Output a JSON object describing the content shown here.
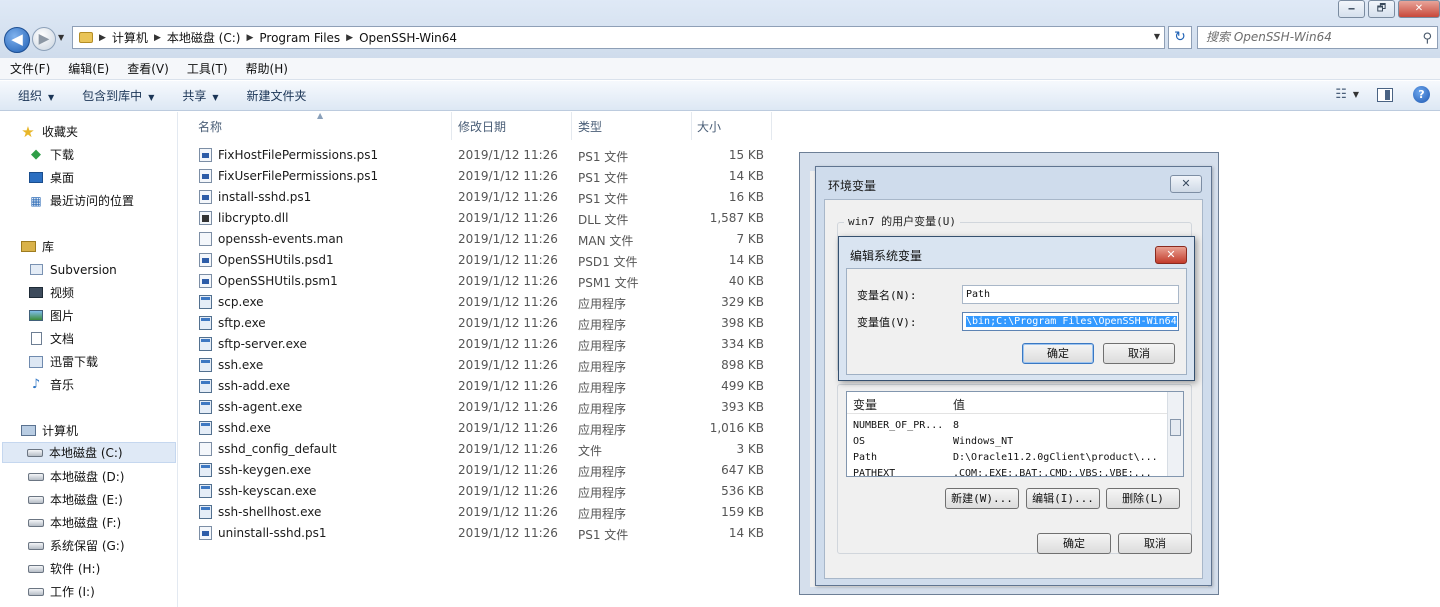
{
  "window": {
    "minimize": "🗕",
    "maximize": "🗗",
    "close": "✕"
  },
  "address": {
    "crumbs": [
      "计算机",
      "本地磁盘 (C:)",
      "Program Files",
      "OpenSSH-Win64"
    ],
    "search_placeholder": "搜索 OpenSSH-Win64"
  },
  "menu": [
    "文件(F)",
    "编辑(E)",
    "查看(V)",
    "工具(T)",
    "帮助(H)"
  ],
  "toolbar": {
    "organize": "组织",
    "include_in_library": "包含到库中",
    "share": "共享",
    "new_folder": "新建文件夹"
  },
  "nav": {
    "favorites": "收藏夹",
    "downloads": "下载",
    "desktop": "桌面",
    "recent": "最近访问的位置",
    "libraries": "库",
    "subversion": "Subversion",
    "videos": "视频",
    "pictures": "图片",
    "documents": "文档",
    "thunder": "迅雷下载",
    "music": "音乐",
    "computer": "计算机",
    "drives": [
      "本地磁盘 (C:)",
      "本地磁盘 (D:)",
      "本地磁盘 (E:)",
      "本地磁盘 (F:)",
      "系统保留 (G:)",
      "软件 (H:)",
      "工作 (I:)"
    ]
  },
  "columns": {
    "name": "名称",
    "date": "修改日期",
    "type": "类型",
    "size": "大小"
  },
  "files": [
    {
      "name": "FixHostFilePermissions.ps1",
      "date": "2019/1/12 11:26",
      "type": "PS1 文件",
      "size": "15 KB",
      "icon": "ps1"
    },
    {
      "name": "FixUserFilePermissions.ps1",
      "date": "2019/1/12 11:26",
      "type": "PS1 文件",
      "size": "14 KB",
      "icon": "ps1"
    },
    {
      "name": "install-sshd.ps1",
      "date": "2019/1/12 11:26",
      "type": "PS1 文件",
      "size": "16 KB",
      "icon": "ps1"
    },
    {
      "name": "libcrypto.dll",
      "date": "2019/1/12 11:26",
      "type": "DLL 文件",
      "size": "1,587 KB",
      "icon": "dll"
    },
    {
      "name": "openssh-events.man",
      "date": "2019/1/12 11:26",
      "type": "MAN 文件",
      "size": "7 KB",
      "icon": "file"
    },
    {
      "name": "OpenSSHUtils.psd1",
      "date": "2019/1/12 11:26",
      "type": "PSD1 文件",
      "size": "14 KB",
      "icon": "ps1"
    },
    {
      "name": "OpenSSHUtils.psm1",
      "date": "2019/1/12 11:26",
      "type": "PSM1 文件",
      "size": "40 KB",
      "icon": "ps1"
    },
    {
      "name": "scp.exe",
      "date": "2019/1/12 11:26",
      "type": "应用程序",
      "size": "329 KB",
      "icon": "exe"
    },
    {
      "name": "sftp.exe",
      "date": "2019/1/12 11:26",
      "type": "应用程序",
      "size": "398 KB",
      "icon": "exe"
    },
    {
      "name": "sftp-server.exe",
      "date": "2019/1/12 11:26",
      "type": "应用程序",
      "size": "334 KB",
      "icon": "exe"
    },
    {
      "name": "ssh.exe",
      "date": "2019/1/12 11:26",
      "type": "应用程序",
      "size": "898 KB",
      "icon": "exe"
    },
    {
      "name": "ssh-add.exe",
      "date": "2019/1/12 11:26",
      "type": "应用程序",
      "size": "499 KB",
      "icon": "exe"
    },
    {
      "name": "ssh-agent.exe",
      "date": "2019/1/12 11:26",
      "type": "应用程序",
      "size": "393 KB",
      "icon": "exe"
    },
    {
      "name": "sshd.exe",
      "date": "2019/1/12 11:26",
      "type": "应用程序",
      "size": "1,016 KB",
      "icon": "exe"
    },
    {
      "name": "sshd_config_default",
      "date": "2019/1/12 11:26",
      "type": "文件",
      "size": "3 KB",
      "icon": "file"
    },
    {
      "name": "ssh-keygen.exe",
      "date": "2019/1/12 11:26",
      "type": "应用程序",
      "size": "647 KB",
      "icon": "exe"
    },
    {
      "name": "ssh-keyscan.exe",
      "date": "2019/1/12 11:26",
      "type": "应用程序",
      "size": "536 KB",
      "icon": "exe"
    },
    {
      "name": "ssh-shellhost.exe",
      "date": "2019/1/12 11:26",
      "type": "应用程序",
      "size": "159 KB",
      "icon": "exe"
    },
    {
      "name": "uninstall-sshd.ps1",
      "date": "2019/1/12 11:26",
      "type": "PS1 文件",
      "size": "14 KB",
      "icon": "ps1"
    }
  ],
  "env_dialog": {
    "title": "环境变量",
    "user_group": "win7 的用户变量(U)",
    "col_var": "变量",
    "col_val": "值",
    "system_vars": [
      {
        "name": "NUMBER_OF_PR...",
        "value": "8"
      },
      {
        "name": "OS",
        "value": "Windows_NT"
      },
      {
        "name": "Path",
        "value": "D:\\Oracle11.2.0gClient\\product\\..."
      },
      {
        "name": "PATHEXT",
        "value": ".COM;.EXE;.BAT;.CMD;.VBS;.VBE;..."
      }
    ],
    "new_btn": "新建(W)...",
    "edit_btn": "编辑(I)...",
    "delete_btn": "删除(L)",
    "ok": "确定",
    "cancel": "取消"
  },
  "edit_dialog": {
    "title": "编辑系统变量",
    "name_label": "变量名(N):",
    "name_value": "Path",
    "value_label": "变量值(V):",
    "value_value": "\\bin;C:\\Program Files\\OpenSSH-Win64",
    "ok": "确定",
    "cancel": "取消"
  }
}
